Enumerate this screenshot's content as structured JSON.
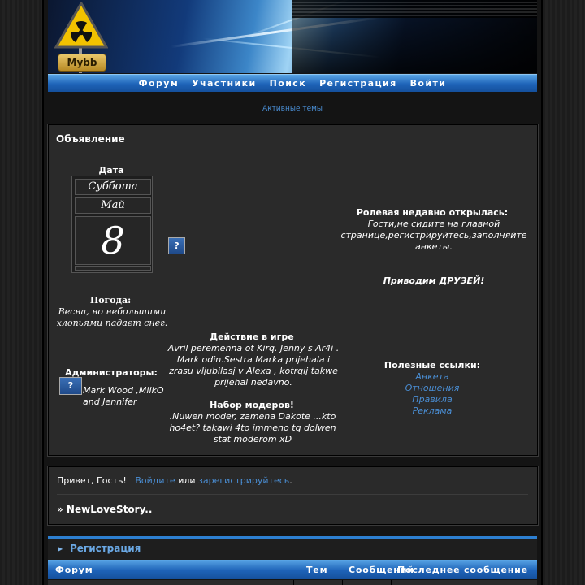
{
  "header": {
    "logo_text": "Mybb"
  },
  "nav": [
    "Форум",
    "Участники",
    "Поиск",
    "Регистрация",
    "Войти"
  ],
  "active_topics": "Активные темы",
  "announcement": {
    "title": "Объявление",
    "date_label": "Дата",
    "day_name": "Суббота",
    "month": "Май",
    "day": "8",
    "weather_label": "Погода:",
    "weather_text": "Весна, но небольшими хлопьями падает снег.",
    "admins_label": "Администраторы:",
    "admins_text": "Mark Wood ,MilkO and Jennifer",
    "roleplay_title": "Ролевая недавно открылась:",
    "roleplay_text": "Гости,не сидите на главной странице,регистрируйтесь,заполняйте анкеты.",
    "friends_text": "Приводим ДРУЗЕЙ!",
    "action_title": "Действие в игре",
    "action_text": "Avril peremenna ot Kirq. Jenny s Ar4i . Mark odin.Sestra Marka prijehala i zrasu vljubilasj v Alexa , kotrqij takwe prijehal nedavno.",
    "mods_title": "Набор модеров!",
    "mods_text": ".Nuwen moder, zamena Dakote ...kto ho4et? takawi 4to immeno tq dolwen stat moderom xD",
    "links_title": "Полезные ссылки:",
    "links": [
      "Анкета",
      "Отношения",
      "Правила",
      "Реклама"
    ]
  },
  "welcome": {
    "greeting": "Привет, Гость!",
    "login_link": "Войдите",
    "or": "или",
    "register_link": "зарегистрируйтесь",
    "period": ".",
    "forum_name": "» NewLoveStory.."
  },
  "category": {
    "title": "Регистрация",
    "columns": [
      "Форум",
      "Тем",
      "Сообщений",
      "Последнее сообщение"
    ]
  },
  "colors": {
    "link": "#4a8ed4",
    "accent_bar": "#1e63b8",
    "background": "#1a1a1a",
    "panel": "#2a2a2a"
  },
  "icons": {
    "logo": "radiation-warning-icon",
    "info": "question-mark-icon"
  }
}
